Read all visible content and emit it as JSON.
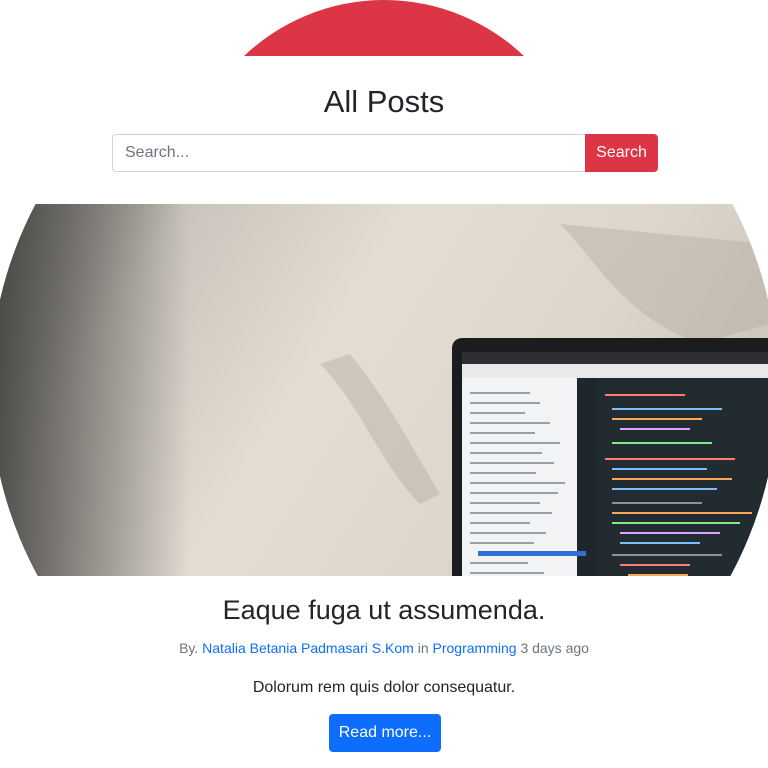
{
  "header": {
    "title": "All Posts",
    "accent_color": "#dc3545"
  },
  "search": {
    "placeholder": "Search...",
    "button_label": "Search"
  },
  "post": {
    "image_description_icon": "laptop-photo",
    "title": "Eaque fuga ut assumenda.",
    "meta": {
      "by_label": "By.",
      "author": "Natalia Betania Padmasari S.Kom",
      "in_label": "in",
      "category": "Programming",
      "time_ago": "3 days ago"
    },
    "excerpt": "Dolorum rem quis dolor consequatur.",
    "read_more_label": "Read more...",
    "link_color": "#0d6efd"
  }
}
